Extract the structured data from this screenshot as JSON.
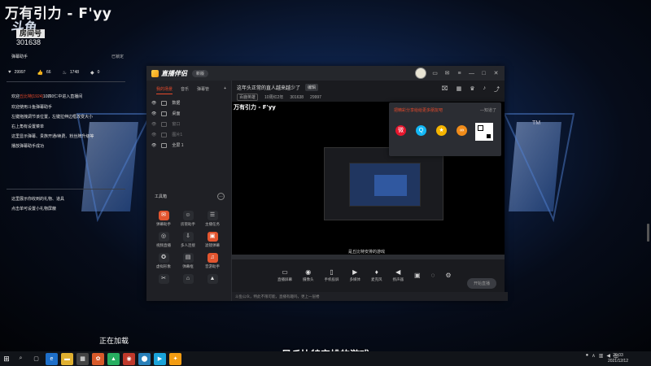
{
  "stream": {
    "title": "万有引力 - F'yy",
    "logo": "斗鱼",
    "room_label": "房间号",
    "room_id": "301638"
  },
  "overlay": {
    "header_left": "弹幕助手",
    "header_right": "已锁定",
    "stats": [
      {
        "icon": "heart-icon",
        "value": "29997"
      },
      {
        "icon": "thumb-icon",
        "value": "66"
      },
      {
        "icon": "flame-icon",
        "value": "1748"
      },
      {
        "icon": "gift-icon",
        "value": "0"
      }
    ],
    "welcome_prefix": "欢迎",
    "welcome_user": "丘比特[1924]",
    "welcome_suffix": "10四0仁中进入直播间",
    "help_lines": [
      "欢迎使用斗鱼弹幕助手",
      "左键拖拽调节该位置，左键拉伸边框改变大小",
      "右上角有设置菜单",
      "这里显示弹幕、贵族开通/续费、粉丝牌升级等",
      "播放弹幕助手成功"
    ],
    "help2_lines": [
      "这里展示你收到的礼物、道具",
      "点击单可设置小礼物屏蔽"
    ]
  },
  "app": {
    "name": "直播伴侣",
    "version": "新版",
    "side_tabs": [
      "我的场景",
      "音乐",
      "弹幕管"
    ],
    "scenes": [
      "数据",
      "桌面",
      "窗口",
      "图片1",
      "全屏 1"
    ],
    "tools_label": "工具箱",
    "tools": [
      {
        "label": "弹幕助手",
        "icon": "chat-icon",
        "glyph": "✉",
        "hot": true
      },
      {
        "label": "房管助手",
        "icon": "user-icon",
        "glyph": "☺",
        "hot": false
      },
      {
        "label": "主播任务",
        "icon": "task-icon",
        "glyph": "☰",
        "hot": false
      },
      {
        "label": "视频直播",
        "icon": "video-icon",
        "glyph": "◎",
        "hot": false
      },
      {
        "label": "多人连接",
        "icon": "download-icon",
        "glyph": "⇩",
        "hot": false
      },
      {
        "label": "滤镜弹幕",
        "icon": "filter-icon",
        "glyph": "▣",
        "hot": true
      },
      {
        "label": "虚拟形象",
        "icon": "avatar-icon",
        "glyph": "✪",
        "hot": false
      },
      {
        "label": "弹幕框",
        "icon": "box-icon",
        "glyph": "▤",
        "hot": false
      },
      {
        "label": "音游助手",
        "icon": "music-icon",
        "glyph": "♫",
        "hot": true
      },
      {
        "label": "",
        "icon": "game-icon",
        "glyph": "✂",
        "hot": false
      },
      {
        "label": "",
        "icon": "stamp-icon",
        "glyph": "⌂",
        "hot": false
      },
      {
        "label": "",
        "icon": "rank-icon",
        "glyph": "▲",
        "hot": false
      }
    ],
    "room_title": "这年头正常的直人越来越少了",
    "edit_label": "编辑",
    "room_category": "百鹿英雄",
    "room_popularity": "10周红2年",
    "room_id": "301638",
    "room_hot": "29997",
    "preview_title": "万有引力 - F'yy",
    "preview_caption": "是丘比特安排的游戏",
    "share": {
      "title": "把精彩分享给给更多朋友吧",
      "close": "—知道了"
    },
    "controls": [
      "直播屏幕",
      "摄像头",
      "手机投屏",
      "多媒体",
      "麦克风",
      "扬声器"
    ],
    "start_button": "开始直播",
    "status_text": "斗鱼公众，特此不限可能，直播有趣吗，更上一层楼"
  },
  "desktop": {
    "loading": "正在加载",
    "subtitle": "是丘比特安排的游戏",
    "tm": "TM"
  },
  "taskbar": {
    "clock_time": "20:03",
    "clock_date": "2021/12/12"
  },
  "colors": {
    "accent": "#e84a2b",
    "bg_blue": "#1d3f7a"
  }
}
